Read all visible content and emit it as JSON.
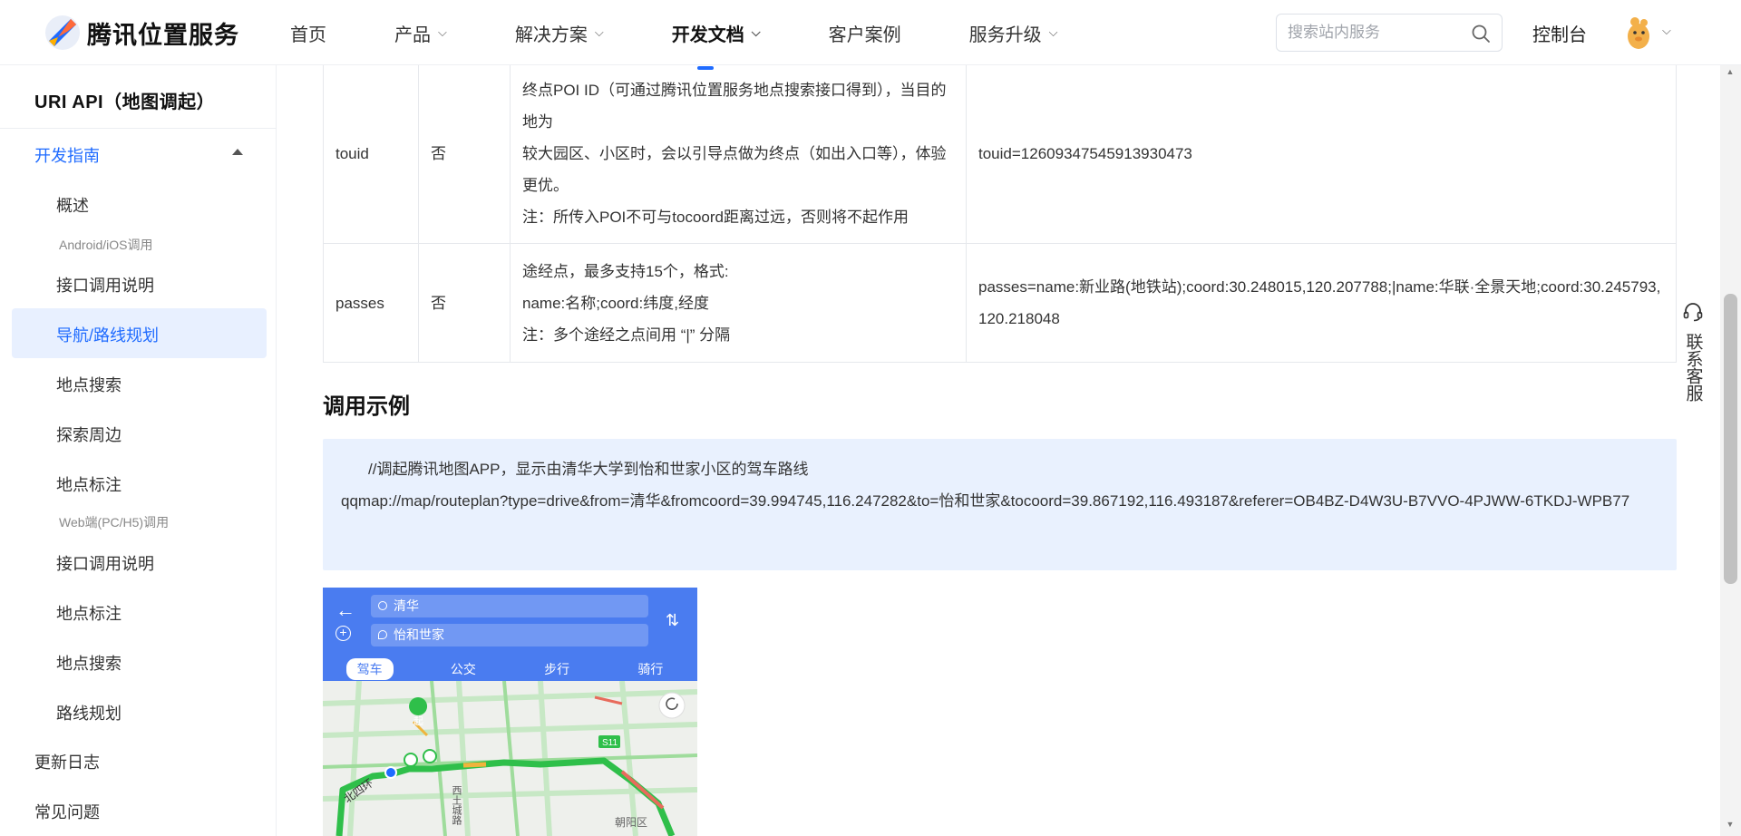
{
  "header": {
    "brand": "腾讯位置服务",
    "nav": [
      {
        "label": "首页",
        "has_menu": false
      },
      {
        "label": "产品",
        "has_menu": true
      },
      {
        "label": "解决方案",
        "has_menu": true
      },
      {
        "label": "开发文档",
        "has_menu": true,
        "active": true
      },
      {
        "label": "客户案例",
        "has_menu": false
      },
      {
        "label": "服务升级",
        "has_menu": true
      }
    ],
    "search_placeholder": "搜索站内服务",
    "console_label": "控制台"
  },
  "sidebar": {
    "title": "URI API（地图调起）",
    "group_open": "开发指南",
    "sub_android": "Android/iOS调用",
    "android_items": [
      "概述",
      "接口调用说明",
      "导航/路线规划",
      "地点搜索",
      "探索周边",
      "地点标注"
    ],
    "sub_web": "Web端(PC/H5)调用",
    "web_items": [
      "接口调用说明",
      "地点标注",
      "地点搜索",
      "路线规划"
    ],
    "bottom_items": [
      "更新日志",
      "常见问题"
    ],
    "active_item": "导航/路线规划"
  },
  "params_table": {
    "rows": [
      {
        "name": "touid",
        "required": "否",
        "desc": [
          "终点POI ID（可通过腾讯位置服务地点搜索接口得到），当目的地为",
          "较大园区、小区时，会以引导点做为终点（如出入口等），体验更优。",
          "注：所传入POI不可与tocoord距离过远，否则将不起作用"
        ],
        "example": "touid=12609347545913930473"
      },
      {
        "name": "passes",
        "required": "否",
        "desc": [
          "途经点，最多支持15个，格式:",
          "name:名称;coord:纬度,经度",
          "注：多个途经之点间用 “|” 分隔"
        ],
        "example": "passes=name:新业路(地铁站);coord:30.248015,120.207788;|name:华联·全景天地;coord:30.245793,120.218048"
      }
    ]
  },
  "section_title": "调用示例",
  "code_example": {
    "comment": "//调起腾讯地图APP，显示由清华大学到怡和世家小区的驾车路线",
    "url": "qqmap://map/routeplan?type=drive&from=清华&fromcoord=39.994745,116.247282&to=怡和世家&tocoord=39.867192,116.493187&referer=OB4BZ-D4W3U-B7VVO-4PJWW-6TKDJ-WPB77"
  },
  "app_screenshot": {
    "from": "清华",
    "to": "怡和世家",
    "tabs": [
      "驾车",
      "公交",
      "步行",
      "骑行"
    ],
    "active_tab": "驾车",
    "map_labels": {
      "start": "起",
      "road_west": "北四环",
      "road_xi": "西土城路",
      "s11": "S11",
      "district": "朝阳区"
    },
    "colors": {
      "header": "#4a7cf0",
      "route": "#2fbf4a",
      "traffic_slow": "#f0b43c",
      "traffic_jam": "#e86b5c"
    }
  },
  "contact": {
    "label": "联系客服"
  },
  "colors": {
    "accent": "#1f6bff",
    "active_bg": "#e8f0ff",
    "code_bg": "#e9f1fe"
  }
}
